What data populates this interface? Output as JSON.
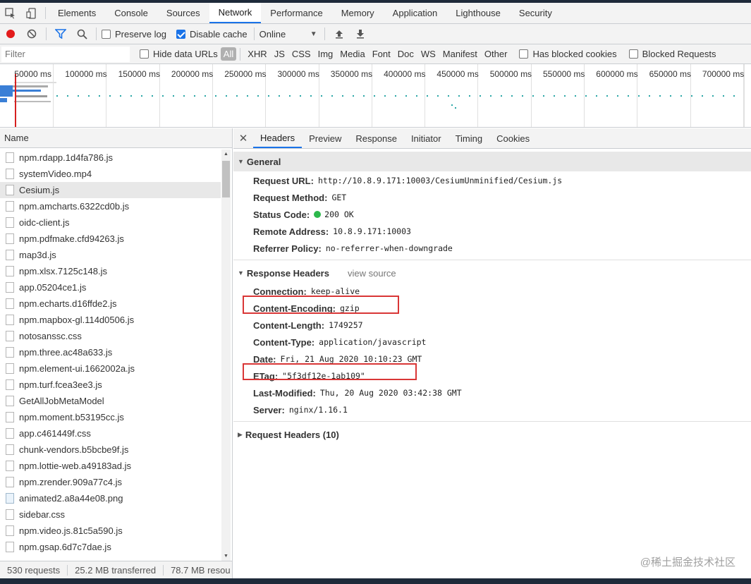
{
  "panel_tabs": [
    "Elements",
    "Console",
    "Sources",
    "Network",
    "Performance",
    "Memory",
    "Application",
    "Lighthouse",
    "Security"
  ],
  "toolbar": {
    "preserve_log": "Preserve log",
    "disable_cache": "Disable cache",
    "throttle": "Online"
  },
  "filter": {
    "placeholder": "Filter",
    "hide_data_urls": "Hide data URLs",
    "types": [
      "All",
      "XHR",
      "JS",
      "CSS",
      "Img",
      "Media",
      "Font",
      "Doc",
      "WS",
      "Manifest",
      "Other"
    ],
    "has_blocked_cookies": "Has blocked cookies",
    "blocked_requests": "Blocked Requests"
  },
  "timeline": {
    "ticks": [
      "50000 ms",
      "100000 ms",
      "150000 ms",
      "200000 ms",
      "250000 ms",
      "300000 ms",
      "350000 ms",
      "400000 ms",
      "450000 ms",
      "500000 ms",
      "550000 ms",
      "600000 ms",
      "650000 ms",
      "700000 ms"
    ]
  },
  "request_list": {
    "header": "Name",
    "items": [
      "npm.rdapp.1d4fa786.js",
      "systemVideo.mp4",
      "Cesium.js",
      "npm.amcharts.6322cd0b.js",
      "oidc-client.js",
      "npm.pdfmake.cfd94263.js",
      "map3d.js",
      "npm.xlsx.7125c148.js",
      "app.05204ce1.js",
      "npm.echarts.d16ffde2.js",
      "npm.mapbox-gl.114d0506.js",
      "notosanssc.css",
      "npm.three.ac48a633.js",
      "npm.element-ui.1662002a.js",
      "npm.turf.fcea3ee3.js",
      "GetAllJobMetaModel",
      "npm.moment.b53195cc.js",
      "app.c461449f.css",
      "chunk-vendors.b5bcbe9f.js",
      "npm.lottie-web.a49183ad.js",
      "npm.zrender.909a77c4.js",
      "animated2.a8a44e08.png",
      "sidebar.css",
      "npm.video.js.81c5a590.js",
      "npm.gsap.6d7c7dae.js"
    ],
    "selected": "Cesium.js"
  },
  "status": {
    "requests": "530 requests",
    "transferred": "25.2 MB transferred",
    "resources": "78.7 MB resou"
  },
  "detail_tabs": [
    "Headers",
    "Preview",
    "Response",
    "Initiator",
    "Timing",
    "Cookies"
  ],
  "general": {
    "title": "General",
    "rows": [
      {
        "k": "Request URL:",
        "v": "http://10.8.9.171:10003/CesiumUnminified/Cesium.js"
      },
      {
        "k": "Request Method:",
        "v": "GET"
      },
      {
        "k": "Status Code:",
        "v": "200 OK"
      },
      {
        "k": "Remote Address:",
        "v": "10.8.9.171:10003"
      },
      {
        "k": "Referrer Policy:",
        "v": "no-referrer-when-downgrade"
      }
    ]
  },
  "response_headers": {
    "title": "Response Headers",
    "view_source": "view source",
    "rows": [
      {
        "k": "Connection:",
        "v": "keep-alive"
      },
      {
        "k": "Content-Encoding:",
        "v": "gzip"
      },
      {
        "k": "Content-Length:",
        "v": "1749257"
      },
      {
        "k": "Content-Type:",
        "v": "application/javascript"
      },
      {
        "k": "Date:",
        "v": "Fri, 21 Aug 2020 10:10:23 GMT"
      },
      {
        "k": "ETag:",
        "v": "\"5f3df12e-1ab109\""
      },
      {
        "k": "Last-Modified:",
        "v": "Thu, 20 Aug 2020 03:42:38 GMT"
      },
      {
        "k": "Server:",
        "v": "nginx/1.16.1"
      }
    ]
  },
  "request_headers": {
    "title": "Request Headers (10)"
  },
  "watermark": "@稀土掘金技术社区"
}
